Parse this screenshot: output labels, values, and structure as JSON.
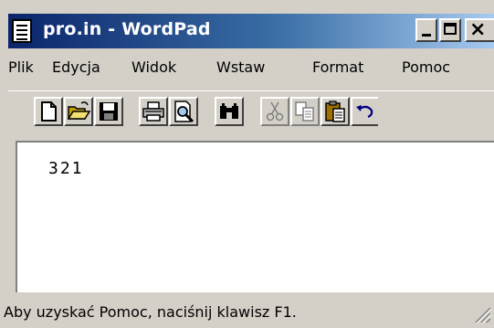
{
  "window": {
    "title": "pro.in - WordPad"
  },
  "caption_buttons": {
    "minimize": "minimize-icon",
    "maximize": "maximize-icon",
    "close_glyph": "×"
  },
  "menu": {
    "items": [
      "Plik",
      "Edycja",
      "Widok",
      "Wstaw",
      "Format",
      "Pomoc"
    ]
  },
  "toolbar": {
    "buttons": [
      {
        "name": "new-document-icon"
      },
      {
        "name": "open-folder-icon"
      },
      {
        "name": "save-icon"
      },
      {
        "name": "print-icon"
      },
      {
        "name": "print-preview-icon"
      },
      {
        "name": "find-binoculars-icon"
      },
      {
        "name": "cut-icon",
        "disabled": true
      },
      {
        "name": "copy-icon",
        "disabled": true
      },
      {
        "name": "paste-icon"
      },
      {
        "name": "undo-icon"
      }
    ]
  },
  "document": {
    "content": "321"
  },
  "status": {
    "text": "Aby uzyskać Pomoc, naciśnij klawisz F1."
  },
  "colors": {
    "title_gradient_start": "#0a246a",
    "title_gradient_end": "#a6caf0",
    "face": "#d4d0c8"
  }
}
